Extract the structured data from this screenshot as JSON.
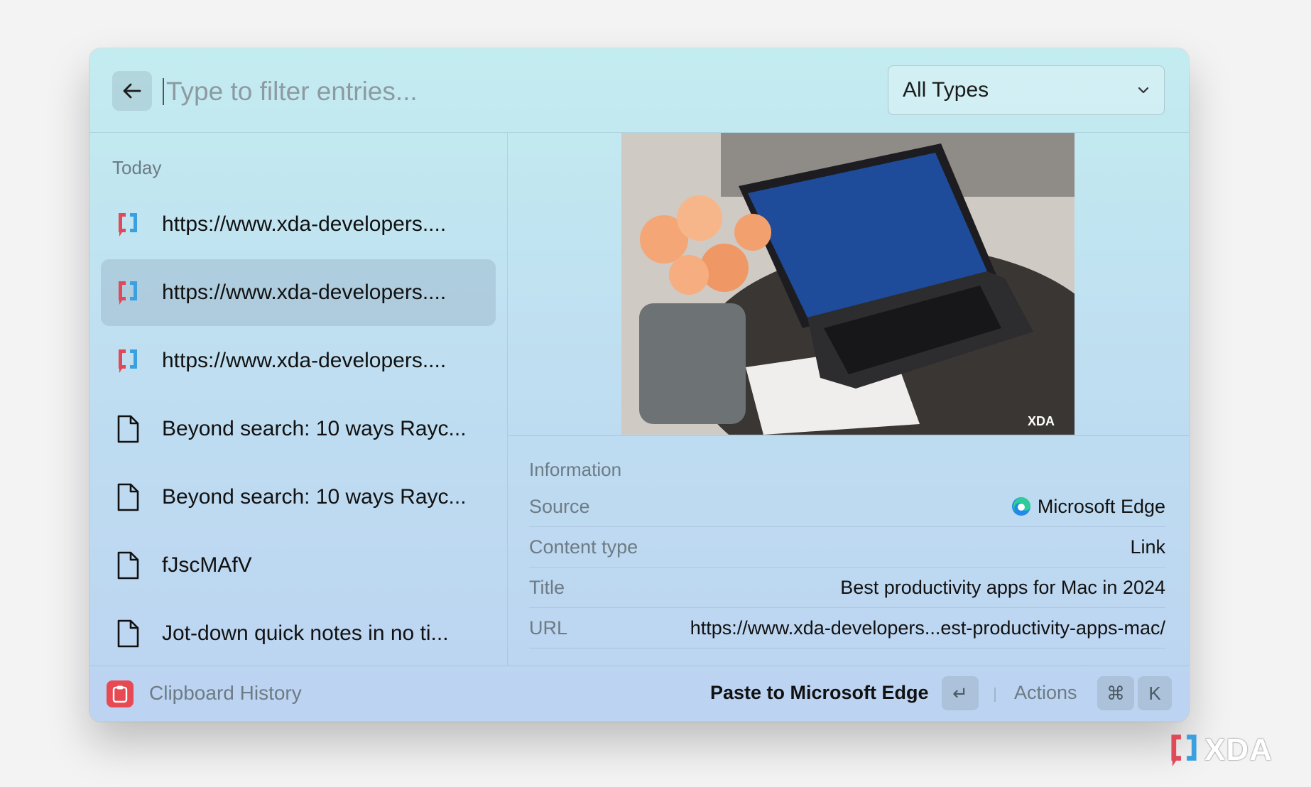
{
  "search": {
    "placeholder": "Type to filter entries...",
    "value": ""
  },
  "filter": {
    "selected": "All Types"
  },
  "list": {
    "section": "Today",
    "items": [
      {
        "icon": "xda-link-icon",
        "label": "https://www.xda-developers...."
      },
      {
        "icon": "xda-link-icon",
        "label": "https://www.xda-developers...."
      },
      {
        "icon": "xda-link-icon",
        "label": "https://www.xda-developers...."
      },
      {
        "icon": "document-icon",
        "label": "Beyond search: 10 ways Rayc..."
      },
      {
        "icon": "document-icon",
        "label": "Beyond search: 10 ways Rayc..."
      },
      {
        "icon": "document-icon",
        "label": "fJscMAfV"
      },
      {
        "icon": "document-icon",
        "label": "Jot-down quick notes in no ti..."
      }
    ],
    "selected_index": 1
  },
  "preview": {
    "watermark": "XDA"
  },
  "info": {
    "title": "Information",
    "rows": [
      {
        "key": "Source",
        "value": "Microsoft Edge",
        "icon": "edge-icon"
      },
      {
        "key": "Content type",
        "value": "Link"
      },
      {
        "key": "Title",
        "value": "Best productivity apps for Mac in 2024"
      },
      {
        "key": "URL",
        "value": "https://www.xda-developers...est-productivity-apps-mac/"
      }
    ]
  },
  "footer": {
    "app_name": "Clipboard History",
    "primary_action": "Paste to Microsoft Edge",
    "enter_key": "↵",
    "actions_label": "Actions",
    "cmd_key": "⌘",
    "k_key": "K"
  },
  "watermark": "XDA",
  "colors": {
    "xda_red": "#e0495a",
    "xda_blue": "#3aa0e0",
    "app_icon": "#e74a52"
  }
}
